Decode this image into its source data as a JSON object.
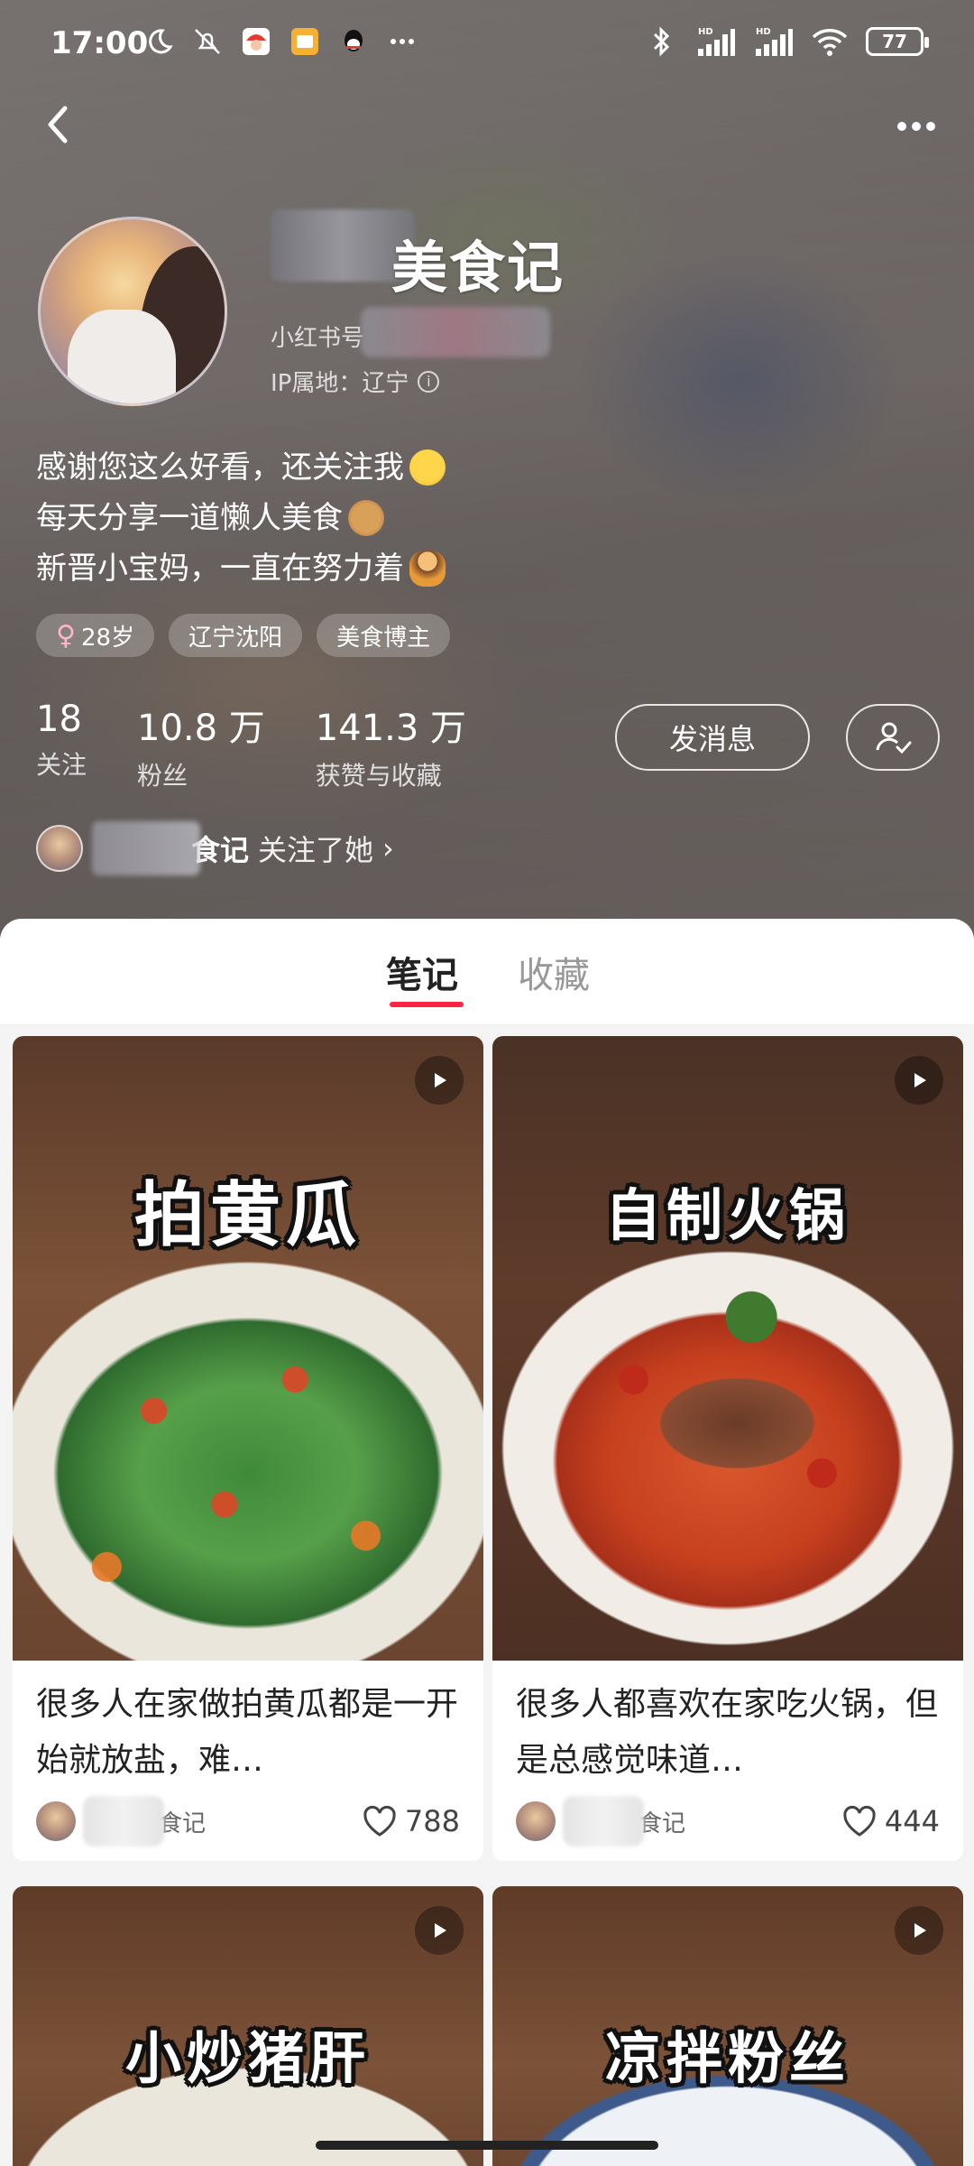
{
  "status_bar": {
    "time": "17:00",
    "battery": "77",
    "icons_left": [
      "moon-icon",
      "mute-icon",
      "santa-app-icon",
      "notes-app-icon",
      "qq-app-icon",
      "more-dots-icon"
    ],
    "icons_right": [
      "bluetooth-icon",
      "signal-hd-icon",
      "signal-hd-icon",
      "wifi-icon",
      "battery-icon"
    ],
    "hd_label": "HD"
  },
  "profile": {
    "nickname": "美食记",
    "redid_label": "小红书号",
    "ip_label": "IP属地：辽宁",
    "bio": [
      "感谢您这么好看，还关注我",
      "每天分享一道懒人美食",
      "新晋小宝妈，一直在努力着"
    ],
    "tags": [
      {
        "label": "28岁",
        "icon": "female-icon"
      },
      {
        "label": "辽宁沈阳"
      },
      {
        "label": "美食博主"
      }
    ],
    "female_symbol": "♀",
    "stats": [
      {
        "value": "18",
        "label": "关注"
      },
      {
        "value": "10.8 万",
        "label": "粉丝"
      },
      {
        "value": "141.3 万",
        "label": "获赞与收藏"
      }
    ],
    "message_button": "发消息",
    "followed_by_name": "食记",
    "followed_by_text": "关注了她",
    "followed_by_chevron": "›"
  },
  "tabs": [
    {
      "label": "笔记",
      "active": true
    },
    {
      "label": "收藏",
      "active": false
    }
  ],
  "notes": [
    {
      "cover_text": "拍黄瓜",
      "title": "很多人在家做拍黄瓜都是一开始就放盐，难…",
      "author": "食记",
      "likes": "788"
    },
    {
      "cover_text": "自制火锅",
      "title": "很多人都喜欢在家吃火锅，但是总感觉味道…",
      "author": "食记",
      "likes": "444"
    },
    {
      "cover_text": "小炒猪肝"
    },
    {
      "cover_text": "凉拌粉丝"
    }
  ],
  "colors": {
    "accent": "#ff2442",
    "header_bg": "#766e6b",
    "card_bg": "#ffffff",
    "page_bg": "#f4f4f4"
  }
}
